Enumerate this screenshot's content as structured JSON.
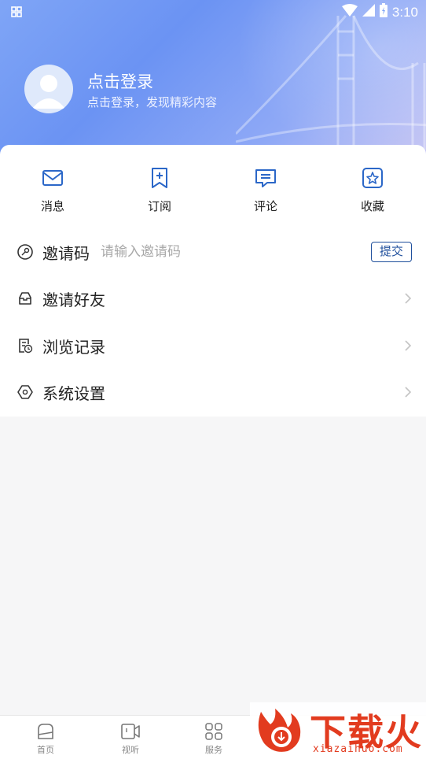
{
  "status_bar": {
    "time": "3:10",
    "icons": [
      "notification-icon",
      "wifi-icon",
      "signal-icon",
      "battery-icon"
    ]
  },
  "profile": {
    "title": "点击登录",
    "subtitle": "点击登录，发现精彩内容"
  },
  "quick_actions": [
    {
      "label": "消息",
      "icon": "message-envelope-icon"
    },
    {
      "label": "订阅",
      "icon": "subscribe-bookmark-icon"
    },
    {
      "label": "评论",
      "icon": "comment-icon"
    },
    {
      "label": "收藏",
      "icon": "favorite-star-icon"
    }
  ],
  "invite": {
    "label": "邀请码",
    "placeholder": "请输入邀请码",
    "submit_label": "提交"
  },
  "menu": [
    {
      "label": "邀请好友",
      "icon": "invite-inbox-icon"
    },
    {
      "label": "浏览记录",
      "icon": "history-icon"
    },
    {
      "label": "系统设置",
      "icon": "settings-icon"
    }
  ],
  "bottom_nav": [
    {
      "label": "首页",
      "icon": "home-icon"
    },
    {
      "label": "视听",
      "icon": "video-icon"
    },
    {
      "label": "服务",
      "icon": "grid-apps-icon"
    }
  ],
  "watermark": {
    "text": "下载火",
    "url": "xiazaihuo.com"
  },
  "colors": {
    "accent": "#1f5fbf",
    "header_gradient_start": "#7fa5f6",
    "header_gradient_end": "#c7c6f4",
    "watermark": "#e23b1f"
  }
}
